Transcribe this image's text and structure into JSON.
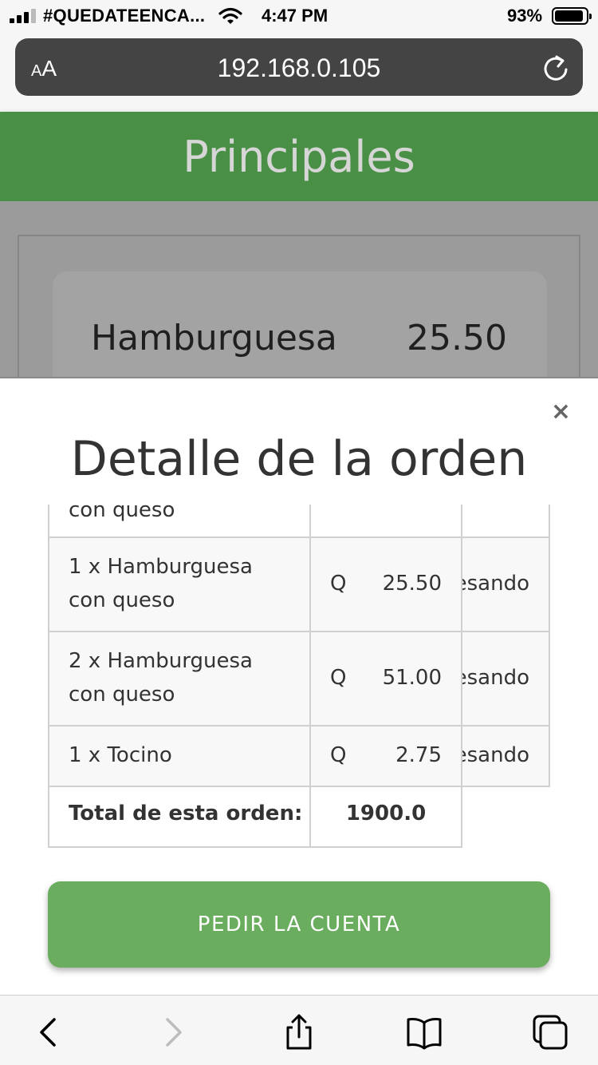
{
  "status_bar": {
    "carrier": "#QUEDATEENCA...",
    "time": "4:47 PM",
    "battery": "93%",
    "battery_level": 0.93
  },
  "browser": {
    "text_size_label_small": "A",
    "text_size_label_big": "A",
    "url": "192.168.0.105"
  },
  "page": {
    "title": "Principales",
    "menu_item": {
      "name": "Hamburguesa",
      "price": "25.50"
    }
  },
  "modal": {
    "close_label": "×",
    "title": "Detalle de la orden",
    "partial_row": {
      "line2": "con queso"
    },
    "rows": [
      {
        "line1": "1 x Hamburguesa",
        "line2": "con queso",
        "currency": "Q",
        "amount": "25.50",
        "status": "esando"
      },
      {
        "line1": "2 x Hamburguesa",
        "line2": "con queso",
        "currency": "Q",
        "amount": "51.00",
        "status": "esando"
      },
      {
        "line1": "1 x Tocino",
        "line2": "",
        "currency": "Q",
        "amount": "2.75",
        "status": "esando"
      }
    ],
    "total_label": "Total de esta orden:",
    "total_value": "1900.0",
    "cta_label": "PEDIR LA CUENTA"
  },
  "toolbar": {
    "icons": [
      "back-icon",
      "forward-icon",
      "share-icon",
      "bookmarks-icon",
      "tabs-icon"
    ]
  }
}
